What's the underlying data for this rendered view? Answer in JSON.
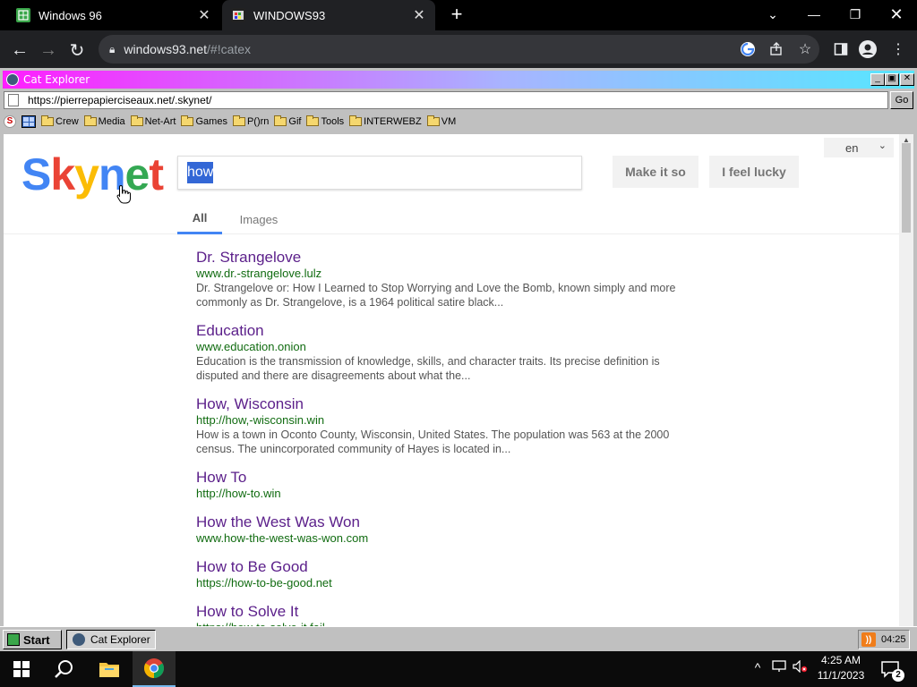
{
  "browser": {
    "tabs": [
      {
        "title": "Windows 96"
      },
      {
        "title": "WINDOWS93"
      }
    ],
    "new_tab": "+",
    "address": {
      "host": "windows93.net",
      "path": "/#!catex"
    }
  },
  "cat_explorer": {
    "title": "Cat Explorer",
    "address": "https://pierrepapierciseaux.net/.skynet/",
    "go_label": "Go",
    "bookmarks": [
      "Crew",
      "Media",
      "Net-Art",
      "Games",
      "P()rn",
      "Gif",
      "Tools",
      "INTERWEBZ",
      "VM"
    ]
  },
  "skynet": {
    "logo": [
      "S",
      "k",
      "y",
      "n",
      "e",
      "t"
    ],
    "logo_colors": [
      "#4285f4",
      "#ea4335",
      "#fbbc05",
      "#4285f4",
      "#34a853",
      "#ea4335"
    ],
    "query": "how",
    "buttons": {
      "search": "Make it so",
      "lucky": "I feel lucky"
    },
    "language": "en",
    "tabs": {
      "all": "All",
      "images": "Images"
    },
    "results": [
      {
        "title": "Dr. Strangelove",
        "url": "www.dr.-strangelove.lulz",
        "desc": "Dr. Strangelove or: How I Learned to Stop Worrying and Love the Bomb, known simply and more commonly as Dr. Strangelove, is a 1964 political satire black..."
      },
      {
        "title": "Education",
        "url": "www.education.onion",
        "desc": "Education is the transmission of knowledge, skills, and character traits. Its precise definition is disputed and there are disagreements about what the..."
      },
      {
        "title": "How, Wisconsin",
        "url": "http://how,-wisconsin.win",
        "desc": "How is a town in Oconto County, Wisconsin, United States. The population was 563 at the 2000 census. The unincorporated community of Hayes is located in..."
      },
      {
        "title": "How To",
        "url": "http://how-to.win",
        "desc": ""
      },
      {
        "title": "How the West Was Won",
        "url": "www.how-the-west-was-won.com",
        "desc": ""
      },
      {
        "title": "How to Be Good",
        "url": "https://how-to-be-good.net",
        "desc": ""
      },
      {
        "title": "How to Solve It",
        "url": "https://how-to-solve-it.fail",
        "desc": ""
      }
    ]
  },
  "w96_taskbar": {
    "start_label": "Start",
    "task_label": "Cat Explorer",
    "tray_time": "04:25"
  },
  "windows_taskbar": {
    "time": "4:25 AM",
    "date": "11/1/2023",
    "notification_count": "2"
  }
}
